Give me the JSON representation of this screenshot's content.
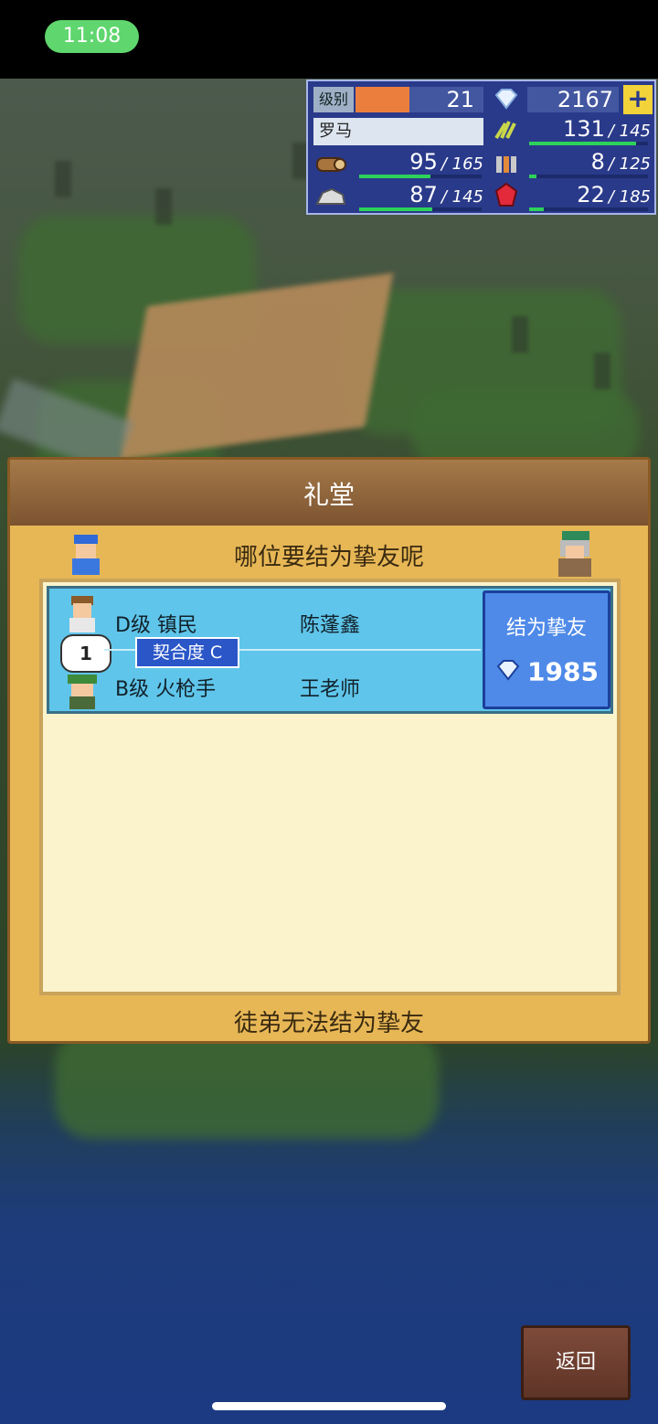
{
  "status_bar": {
    "time": "11:08"
  },
  "resources": {
    "level_label": "级别",
    "level_value": "21",
    "level_progress": 0.42,
    "gems": "2167",
    "plus": "+",
    "city": "罗马",
    "food": {
      "value": "131",
      "max": "145",
      "fill": 0.9
    },
    "wood": {
      "value": "95",
      "max": "165",
      "fill": 0.58
    },
    "ore": {
      "value": "8",
      "max": "125",
      "fill": 0.06
    },
    "stone": {
      "value": "87",
      "max": "145",
      "fill": 0.6
    },
    "ruby": {
      "value": "22",
      "max": "185",
      "fill": 0.12
    },
    "icons": [
      "gem-icon",
      "wheat-icon",
      "log-icon",
      "tools-icon",
      "stone-icon",
      "ruby-icon"
    ]
  },
  "dialog": {
    "title": "礼堂",
    "prompt": "哪位要结为挚友呢",
    "pair": {
      "rank_index": "1",
      "first": {
        "rank_job": "D级 镇民",
        "name": "陈蓬鑫"
      },
      "second": {
        "rank_job": "B级 火枪手",
        "name": "王老师"
      },
      "compatibility": "契合度 C",
      "action_label": "结为挚友",
      "cost": "1985"
    },
    "footer_note": "徒弟无法结为挚友"
  },
  "back_button": "返回",
  "colors": {
    "accent_blue": "#4f8ae8",
    "panel": "#e7b756",
    "row": "#5fc5ea",
    "bar": "#2ed25a"
  }
}
